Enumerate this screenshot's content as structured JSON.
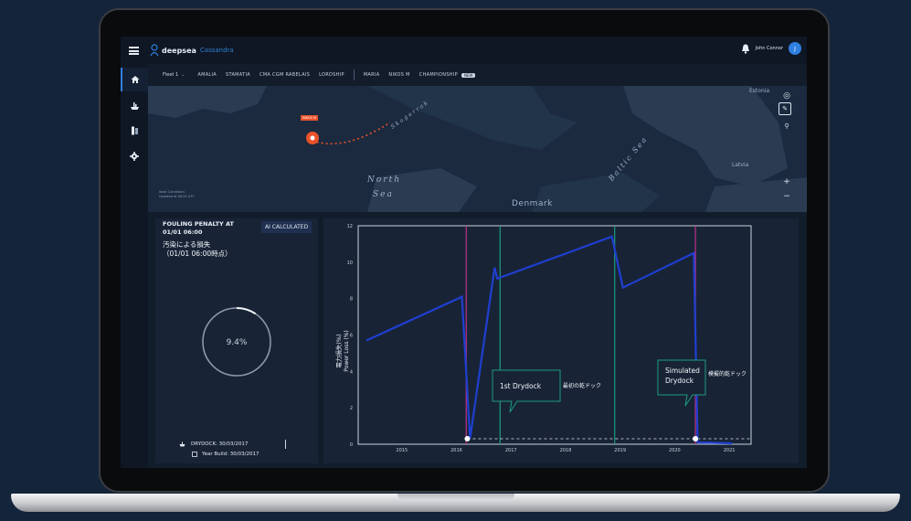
{
  "app": {
    "brand": "deepsea",
    "brand_sub": "Cassandra",
    "user_name": "John Connor",
    "avatar_initial": "J"
  },
  "tabs": {
    "fleet": "Fleet 1",
    "ships": [
      "AMALIA",
      "STAMATIA",
      "CMA CGM RABELAIS",
      "LORDSHIP",
      "MARIA",
      "NIKOS M",
      "CHAMPIONSHIP"
    ],
    "new_badge": "NEW"
  },
  "map": {
    "labels": {
      "north_sea": [
        "North",
        "Sea"
      ],
      "skagerrak": "Skagerrak",
      "baltic": "Baltic Sea",
      "denmark": "Denmark",
      "estonia": "Estonia",
      "latvia": "Latvia"
    },
    "vessel_tag": "NIKOS M",
    "updated_line1": "Ideal Conditions",
    "updated_line2": "Updated at 06:00 UTC"
  },
  "fouling": {
    "title_line1": "FOULING PENALTY AT",
    "title_line2": "01/01 06:00",
    "title_jp_line1": "汚染による損失",
    "title_jp_line2": "（01/01 06:00時点）",
    "ai_badge": "AI CALCULATED",
    "value": "9.4%",
    "gauge_fraction": 0.094,
    "drydock": "DRYDOCK:  30/03/2017",
    "year_build": "Year Build:  30/03/2017"
  },
  "chart_data": {
    "type": "line",
    "ylabel_jp": "電力損失(%)",
    "ylabel": "Power Loss (%)",
    "ylim": [
      0,
      12
    ],
    "xlim": [
      2014.2,
      2021.4
    ],
    "x_ticks": [
      2015,
      2016,
      2017,
      2018,
      2019,
      2020,
      2021
    ],
    "y_ticks": [
      0,
      2,
      4,
      6,
      8,
      10,
      12
    ],
    "series": [
      {
        "points": [
          [
            2014.35,
            5.7
          ],
          [
            2016.1,
            8.1
          ],
          [
            2016.25,
            0.3
          ],
          [
            2016.7,
            9.7
          ],
          [
            2016.75,
            9.1
          ],
          [
            2018.85,
            11.4
          ],
          [
            2019.05,
            8.6
          ],
          [
            2020.35,
            10.5
          ],
          [
            2020.42,
            0.1
          ],
          [
            2021.05,
            0.05
          ]
        ]
      }
    ],
    "baseline": 0.3,
    "markers": [
      [
        2016.2,
        0.3
      ],
      [
        2020.38,
        0.3
      ]
    ],
    "vlines_magenta": [
      2016.18,
      2020.38
    ],
    "vlines_green": [
      2016.8,
      2018.9
    ],
    "annotations": [
      {
        "text": "1st Drydock",
        "text_jp": "最初の乾ドック"
      },
      {
        "text": "Simulated",
        "text2": "Drydock",
        "text_jp": "模擬的乾ドック"
      }
    ]
  },
  "colors": {
    "accent": "#2f7fe0",
    "line": "#1f3fd0",
    "magenta": "#c0308a",
    "green": "#1e9a80",
    "vessel": "#e8522a"
  }
}
